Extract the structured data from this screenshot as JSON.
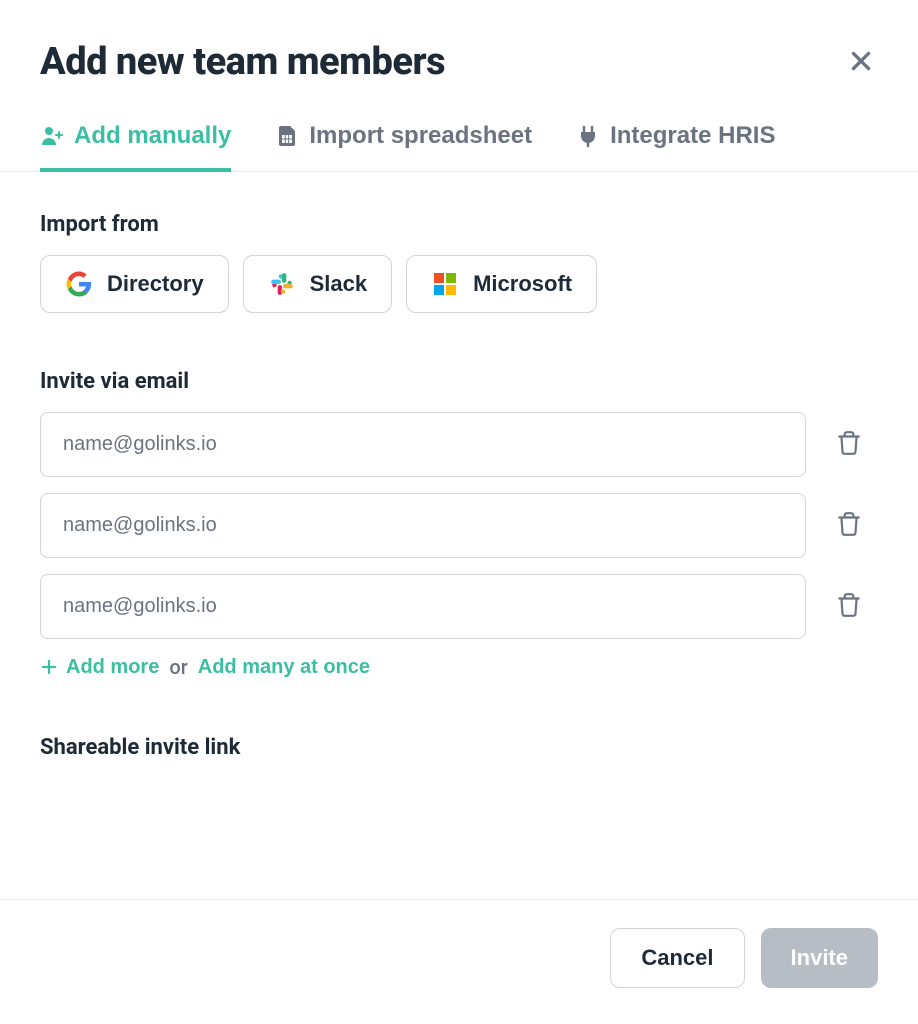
{
  "header": {
    "title": "Add new team members"
  },
  "tabs": [
    {
      "label": "Add manually"
    },
    {
      "label": "Import spreadsheet"
    },
    {
      "label": "Integrate HRIS"
    }
  ],
  "import": {
    "label": "Import from",
    "providers": [
      {
        "label": "Directory"
      },
      {
        "label": "Slack"
      },
      {
        "label": "Microsoft"
      }
    ]
  },
  "invite": {
    "label": "Invite via email",
    "placeholder": "name@golinks.io",
    "rows": 3,
    "add_more": "Add more",
    "or": "or",
    "add_many": "Add many at once"
  },
  "shareable": {
    "label": "Shareable invite link"
  },
  "footer": {
    "cancel": "Cancel",
    "invite": "Invite"
  }
}
